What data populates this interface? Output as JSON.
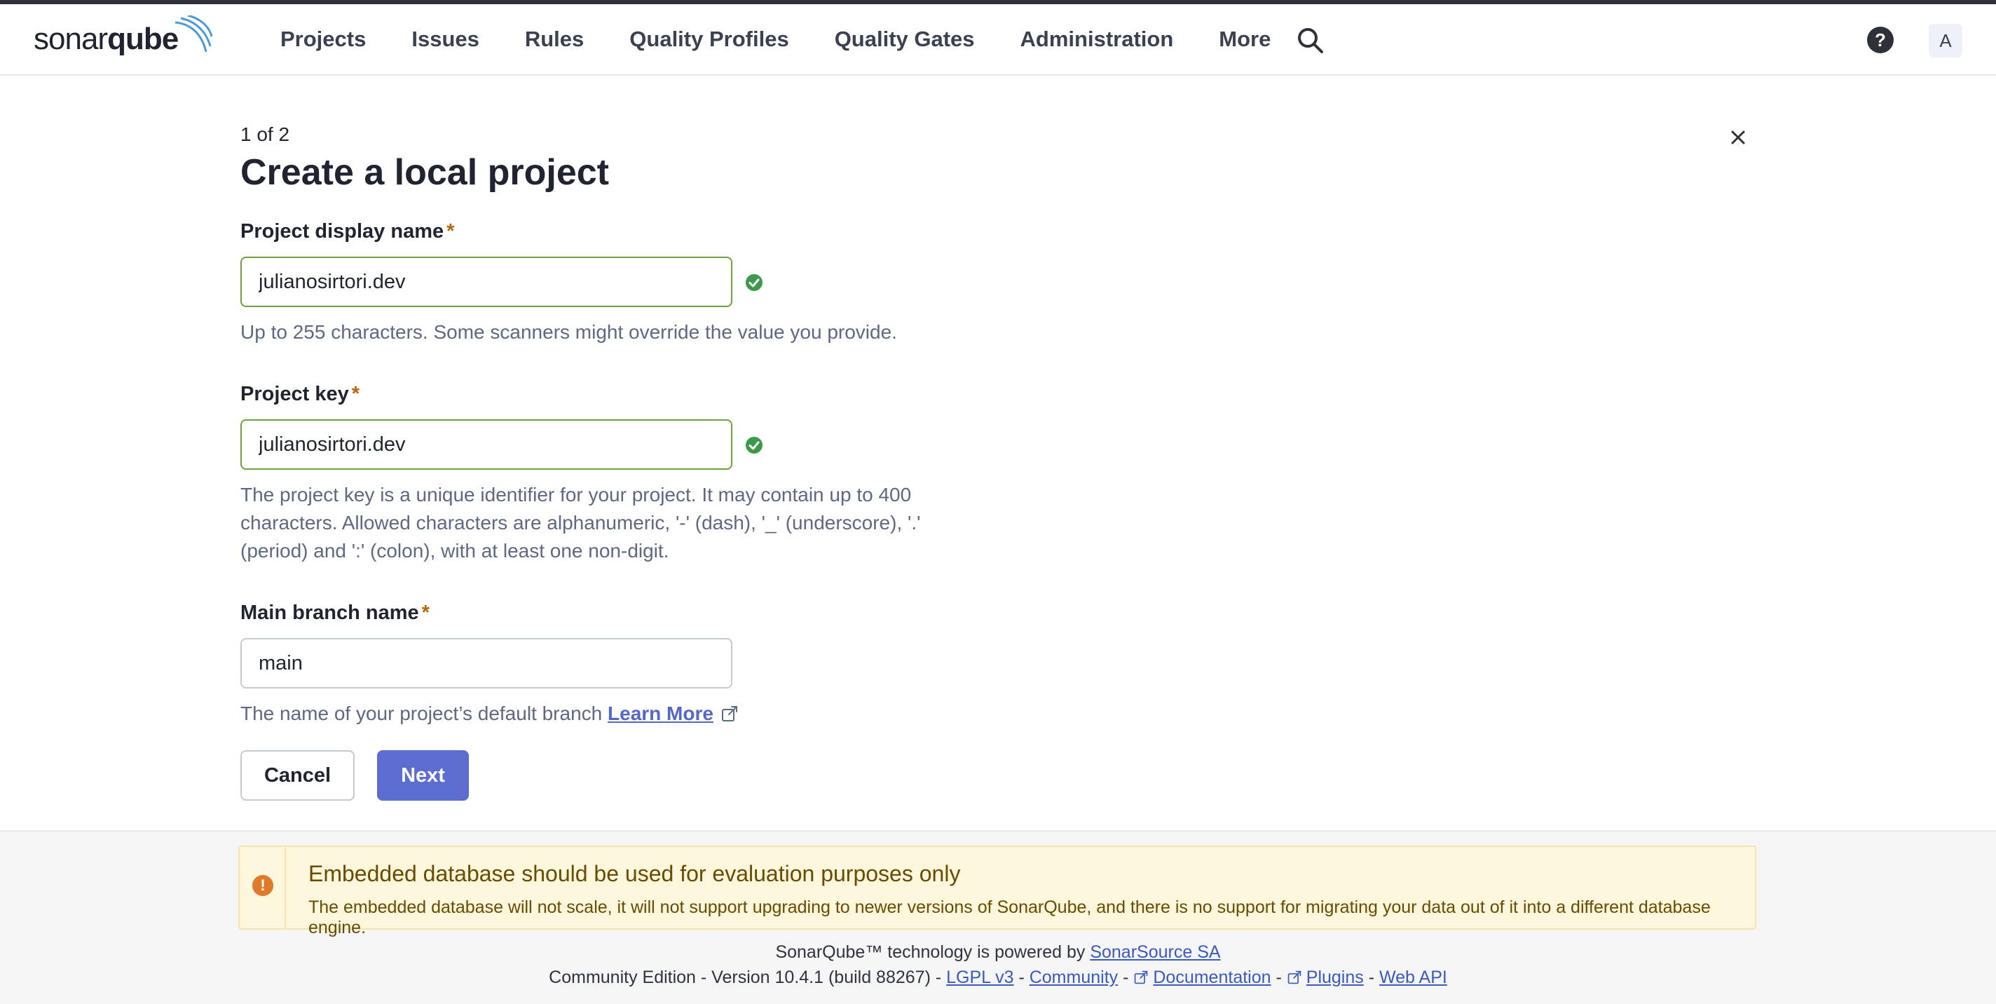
{
  "app": {
    "logo_regular": "sonar",
    "logo_bold": "qube"
  },
  "nav": {
    "items": [
      "Projects",
      "Issues",
      "Rules",
      "Quality Profiles",
      "Quality Gates",
      "Administration",
      "More"
    ],
    "avatar_initial": "A",
    "help_label": "?"
  },
  "wizard": {
    "step": "1 of 2",
    "title": "Create a local project",
    "required_marker": "*",
    "display_name": {
      "label": "Project display name",
      "value": "julianosirtori.dev",
      "help": "Up to 255 characters. Some scanners might override the value you provide."
    },
    "project_key": {
      "label": "Project key",
      "value": "julianosirtori.dev",
      "help_line1": "The project key is a unique identifier for your project. It may contain up to 400",
      "help_line2": "characters. Allowed characters are alphanumeric, '-' (dash), '_' (underscore), '.'",
      "help_line3": "(period) and ':' (colon), with at least one non-digit."
    },
    "branch": {
      "label": "Main branch name",
      "value": "main",
      "help": "The name of your project’s default branch",
      "learn_more": "Learn More"
    },
    "cancel_label": "Cancel",
    "next_label": "Next"
  },
  "warning": {
    "title": "Embedded database should be used for evaluation purposes only",
    "text": "The embedded database will not scale, it will not support upgrading to newer versions of SonarQube, and there is no support for migrating your data out of it into a different database engine.",
    "icon": "!"
  },
  "footer": {
    "powered_prefix": "SonarQube™ technology is powered by",
    "powered_link": "SonarSource SA",
    "edition": "Community Edition - Version 10.4.1 (build 88267) -",
    "sep": "-",
    "links": [
      "LGPL v3",
      "Community",
      "Documentation",
      "Plugins",
      "Web API"
    ]
  },
  "colors": {
    "primary": "#5d6ccf",
    "valid_border": "#6ea23e",
    "valid_icon": "#3c9a4b",
    "warning_bg": "#fcf6dd",
    "warning_icon": "#e07a2b"
  },
  "icons": [
    "search-icon",
    "help-icon",
    "close-icon",
    "check-circle-icon",
    "external-link-icon",
    "warning-icon"
  ]
}
